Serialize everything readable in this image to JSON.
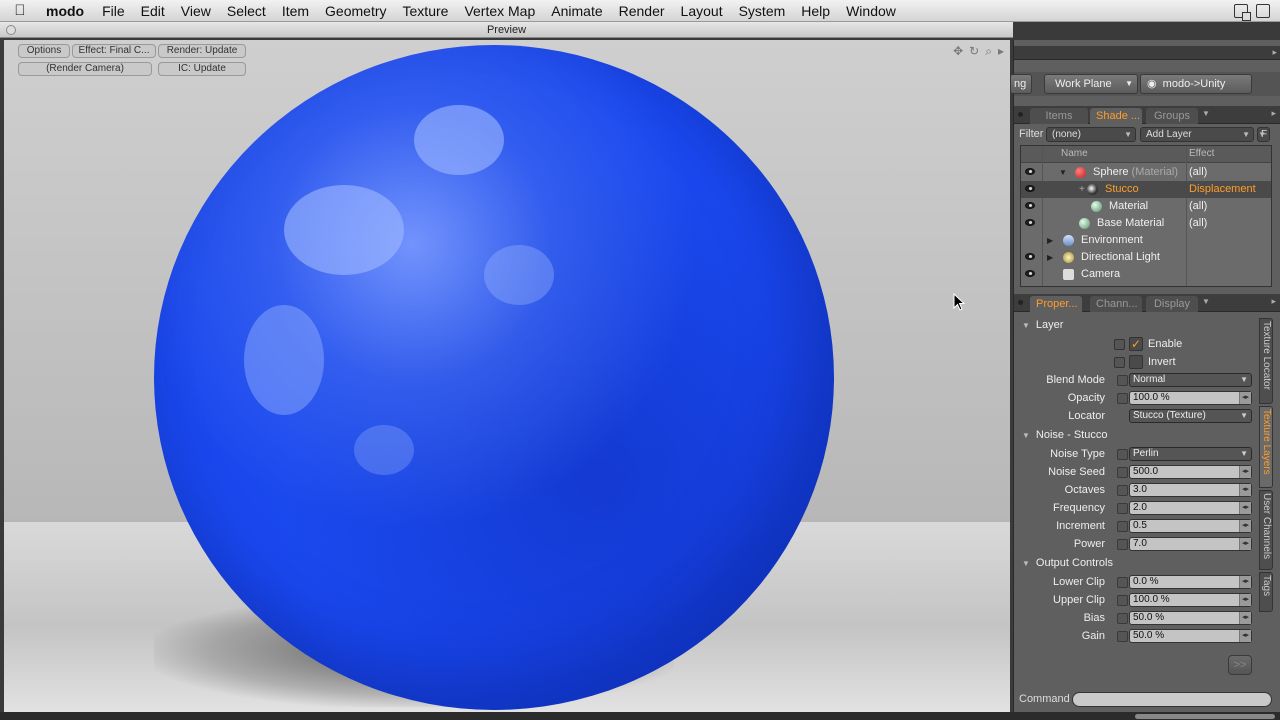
{
  "menubar": {
    "apple_icon": "apple-icon",
    "app_name": "modo",
    "items": [
      "File",
      "Edit",
      "View",
      "Select",
      "Item",
      "Geometry",
      "Texture",
      "Vertex Map",
      "Animate",
      "Render",
      "Layout",
      "System",
      "Help",
      "Window"
    ]
  },
  "preview": {
    "title": "Preview",
    "chips": {
      "options": "Options",
      "effect": "Effect: Final C...",
      "render": "Render: Update",
      "camera": "(Render Camera)",
      "ic": "IC: Update"
    },
    "object_color": "#1c4bf0"
  },
  "toolbar": {
    "partial_label": "ng",
    "work_plane": "Work Plane",
    "unity": "modo->Unity"
  },
  "shader_tabs": [
    "Items",
    "Shade ...",
    "Groups"
  ],
  "filter": {
    "label": "Filter",
    "value": "(none)",
    "add_layer": "Add Layer",
    "f_button": "F"
  },
  "tree": {
    "col_name": "Name",
    "col_effect": "Effect",
    "rows": [
      {
        "name": "Sphere",
        "sub": "(Material)",
        "effect": "(all)"
      },
      {
        "name": "Stucco",
        "sub": "",
        "effect": "Displacement"
      },
      {
        "name": "Material",
        "sub": "",
        "effect": "(all)"
      },
      {
        "name": "Base Material",
        "sub": "",
        "effect": "(all)"
      },
      {
        "name": "Environment",
        "sub": "",
        "effect": ""
      },
      {
        "name": "Directional Light",
        "sub": "",
        "effect": ""
      },
      {
        "name": "Camera",
        "sub": "",
        "effect": ""
      }
    ]
  },
  "prop_tabs": [
    "Proper...",
    "Chann...",
    "Display"
  ],
  "props": {
    "layer_section": "Layer",
    "enable": "Enable",
    "invert": "Invert",
    "blend_mode_label": "Blend Mode",
    "blend_mode": "Normal",
    "opacity_label": "Opacity",
    "opacity": "100.0 %",
    "locator_label": "Locator",
    "locator": "Stucco (Texture)",
    "noise_section": "Noise - Stucco",
    "noise_type_label": "Noise Type",
    "noise_type": "Perlin",
    "noise_seed_label": "Noise Seed",
    "noise_seed": "500.0",
    "octaves_label": "Octaves",
    "octaves": "3.0",
    "frequency_label": "Frequency",
    "frequency": "2.0",
    "increment_label": "Increment",
    "increment": "0.5",
    "power_label": "Power",
    "power": "7.0",
    "output_section": "Output Controls",
    "lower_clip_label": "Lower Clip",
    "lower_clip": "0.0 %",
    "upper_clip_label": "Upper Clip",
    "upper_clip": "100.0 %",
    "bias_label": "Bias",
    "bias": "50.0 %",
    "gain_label": "Gain",
    "gain": "50.0 %",
    "more_button": ">>"
  },
  "vtabs": [
    "Texture Locator",
    "Texture Layers",
    "User Channels",
    "Tags"
  ],
  "command": {
    "label": "Command"
  },
  "colors": {
    "accent": "#ff9d2a",
    "panel": "#5f5f5f"
  }
}
